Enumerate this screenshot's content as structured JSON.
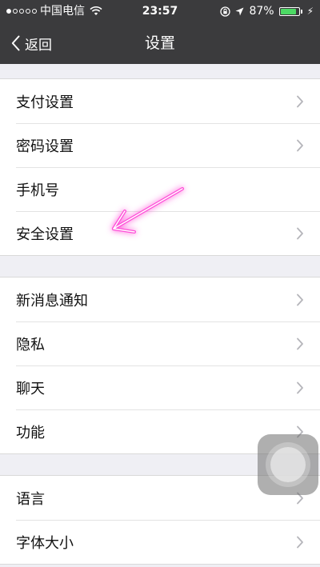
{
  "status_bar": {
    "carrier": "中国电信",
    "time": "23:57",
    "battery_percent": "87%",
    "battery_level": 0.87,
    "battery_color": "#4cd964"
  },
  "nav": {
    "back_label": "返回",
    "title": "设置"
  },
  "colors": {
    "header_bg": "#3b3b3d",
    "page_bg": "#efeff4",
    "annotation_arrow": "#ff4fd8"
  },
  "sections": [
    {
      "items": [
        {
          "label": "支付设置",
          "chevron": true
        },
        {
          "label": "密码设置",
          "chevron": true
        },
        {
          "label": "手机号",
          "chevron": false
        },
        {
          "label": "安全设置",
          "chevron": true
        }
      ]
    },
    {
      "items": [
        {
          "label": "新消息通知",
          "chevron": true
        },
        {
          "label": "隐私",
          "chevron": true
        },
        {
          "label": "聊天",
          "chevron": true
        },
        {
          "label": "功能",
          "chevron": true
        }
      ]
    },
    {
      "items": [
        {
          "label": "语言",
          "chevron": true
        },
        {
          "label": "字体大小",
          "chevron": true
        }
      ]
    }
  ],
  "icons": {
    "back": "chevron-left-icon",
    "row": "chevron-right-icon",
    "wifi": "wifi-icon",
    "location": "location-arrow-icon",
    "lock": "orientation-lock-icon",
    "battery": "battery-icon",
    "charging": "charging-bolt-icon",
    "annotation": "hand-drawn-arrow-icon",
    "assistive": "assistive-touch-icon"
  }
}
